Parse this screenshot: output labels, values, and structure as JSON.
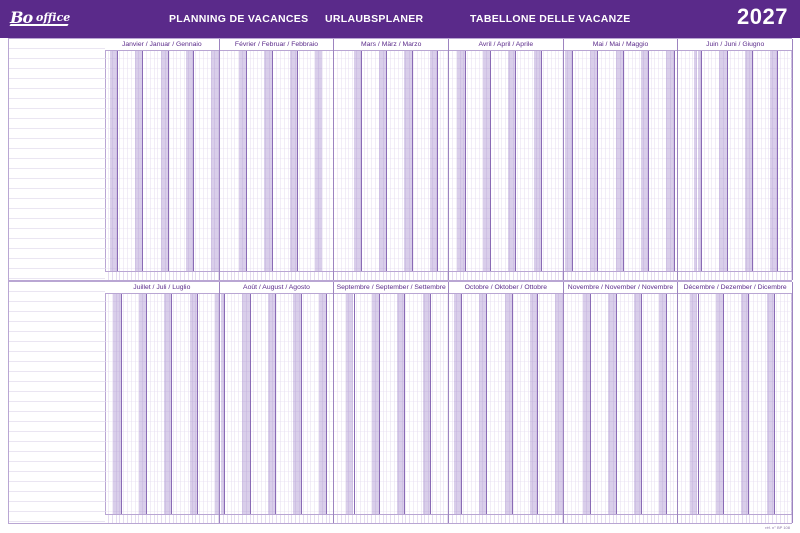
{
  "header": {
    "brand": "office",
    "title_fr": "PLANNING DE VACANCES",
    "title_de": "URLAUBSPLANER",
    "title_it": "TABELLONE DELLE VACANZE",
    "year": "2027"
  },
  "colors": {
    "brand_purple": "#5a2a8a",
    "weekend": "#b9a3d6",
    "grid": "#d6cbe6"
  },
  "top_months": [
    {
      "label": "Janvier / Januar / Gennaio",
      "days": 31,
      "first_weekday": 4
    },
    {
      "label": "Février / Februar / Febbraio",
      "days": 28,
      "first_weekday": 0
    },
    {
      "label": "Mars / März / Marzo",
      "days": 31,
      "first_weekday": 0
    },
    {
      "label": "Avril / April / Aprile",
      "days": 30,
      "first_weekday": 3
    },
    {
      "label": "Mai / Mai / Maggio",
      "days": 31,
      "first_weekday": 5
    },
    {
      "label": "Juin / Juni / Giugno",
      "days": 30,
      "first_weekday": 1
    }
  ],
  "bottom_months": [
    {
      "label": "Juillet / Juli / Luglio",
      "days": 31,
      "first_weekday": 3
    },
    {
      "label": "Août / August / Agosto",
      "days": 31,
      "first_weekday": 6
    },
    {
      "label": "Septembre / September / Settembre",
      "days": 30,
      "first_weekday": 2
    },
    {
      "label": "Octobre / Oktober / Ottobre",
      "days": 31,
      "first_weekday": 4
    },
    {
      "label": "Novembre / November / Novembre",
      "days": 30,
      "first_weekday": 0
    },
    {
      "label": "Décembre / Dezember / Dicembre",
      "days": 31,
      "first_weekday": 2
    }
  ],
  "footnote": "réf. n° BP 108"
}
